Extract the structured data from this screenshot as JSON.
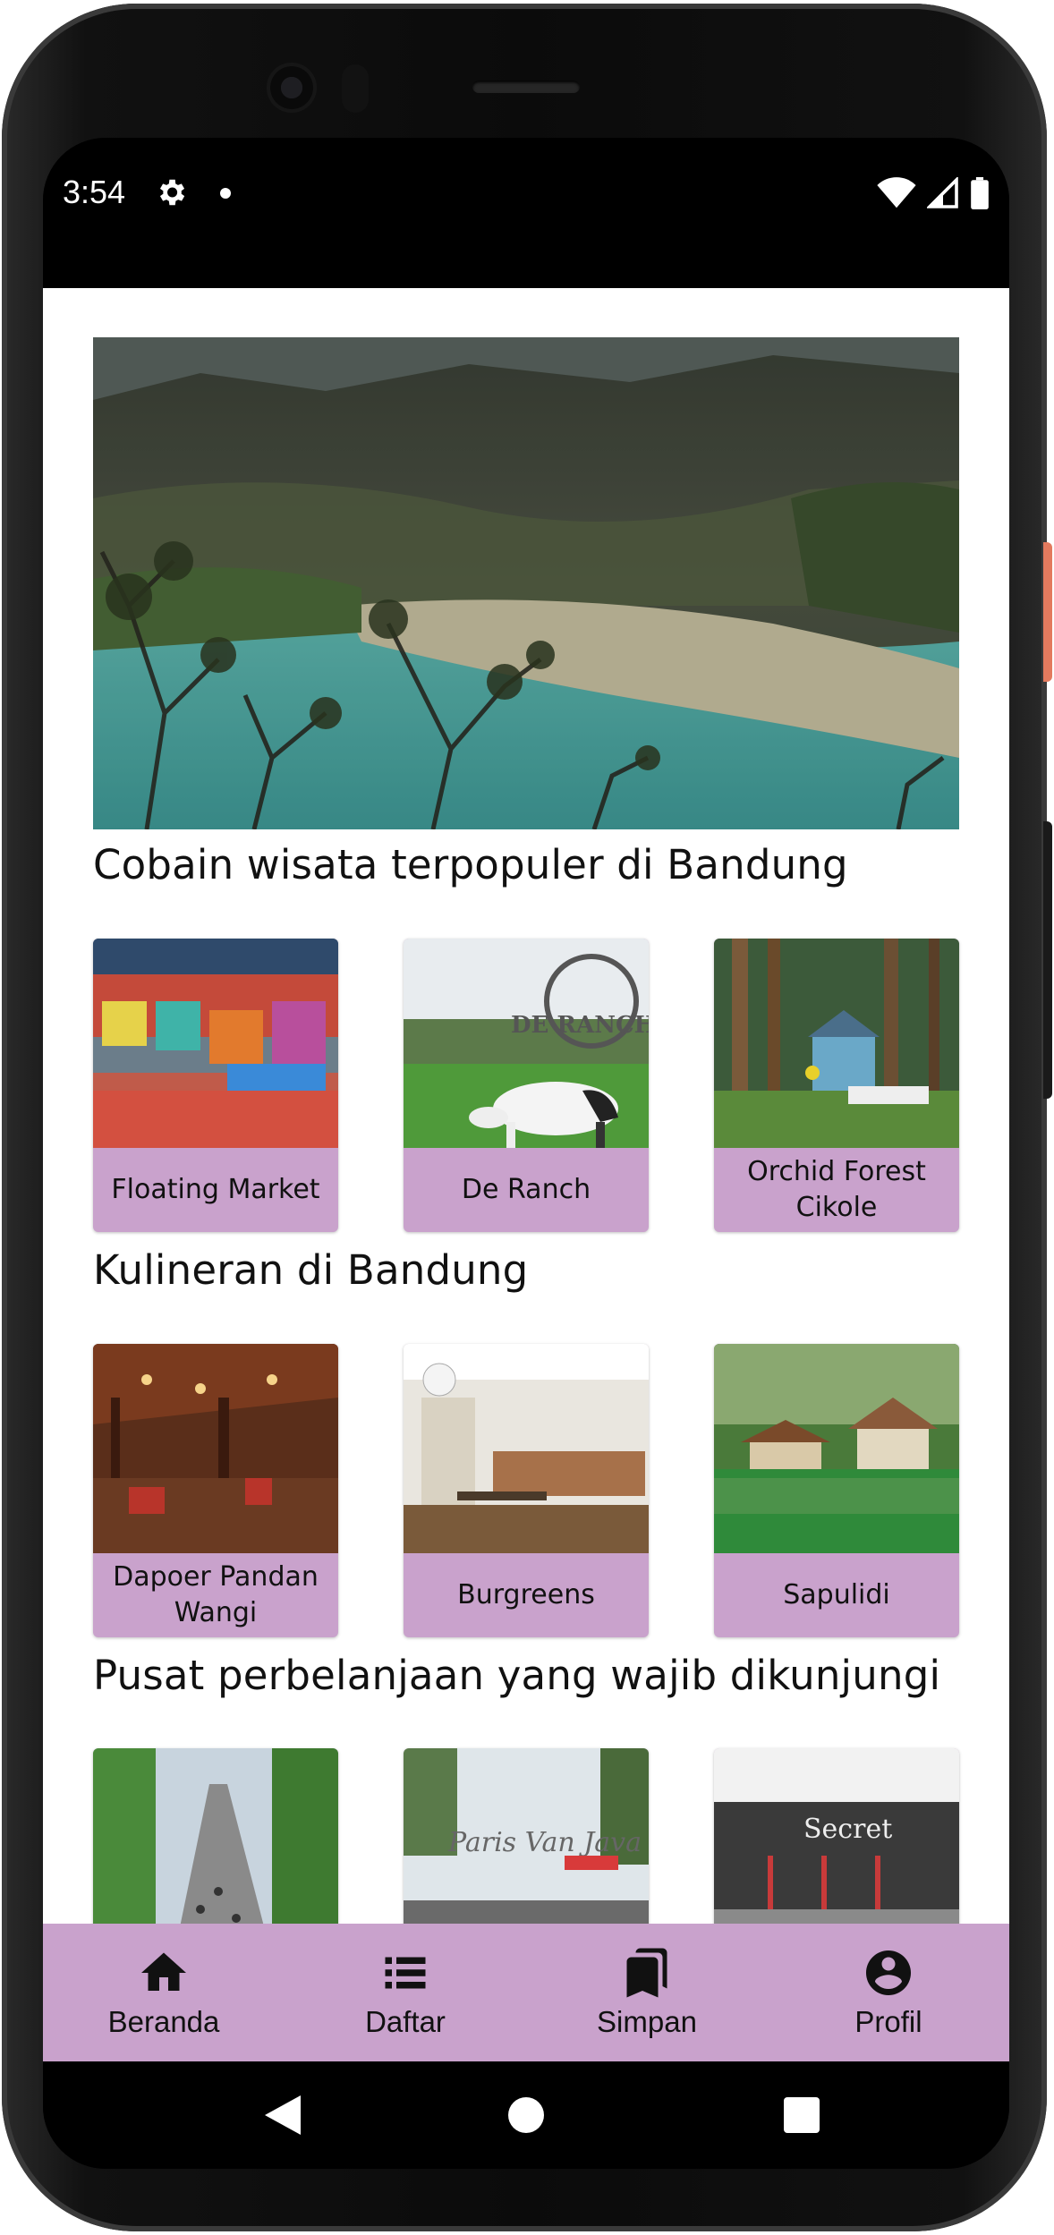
{
  "status_bar": {
    "time": "3:54"
  },
  "hero": {
    "image": "kawah-putih-crater-lake"
  },
  "sections": [
    {
      "title": "Cobain wisata terpopuler di Bandung",
      "cards": [
        {
          "label": "Floating Market",
          "image": "floating-market"
        },
        {
          "label": "De Ranch",
          "image": "de-ranch"
        },
        {
          "label": "Orchid Forest Cikole",
          "image": "orchid-forest"
        }
      ]
    },
    {
      "title": "Kulineran di Bandung",
      "cards": [
        {
          "label": "Dapoer Pandan Wangi",
          "image": "dapoer-pandan-wangi"
        },
        {
          "label": "Burgreens",
          "image": "burgreens"
        },
        {
          "label": "Sapulidi",
          "image": "sapulidi"
        }
      ]
    },
    {
      "title": "Pusat perbelanjaan yang wajib dikunjungi",
      "cards": [
        {
          "label": "",
          "image": "street-market"
        },
        {
          "label": "",
          "image": "paris-van-java"
        },
        {
          "label": "",
          "image": "the-secret-factory-outlet"
        }
      ]
    }
  ],
  "bottom_nav": [
    {
      "label": "Beranda",
      "icon": "home-icon"
    },
    {
      "label": "Daftar",
      "icon": "list-icon"
    },
    {
      "label": "Simpan",
      "icon": "bookmarks-icon"
    },
    {
      "label": "Profil",
      "icon": "account-circle-icon"
    }
  ],
  "colors": {
    "accent": "#c9a2cc",
    "background": "#ffffff",
    "text": "#111111"
  }
}
